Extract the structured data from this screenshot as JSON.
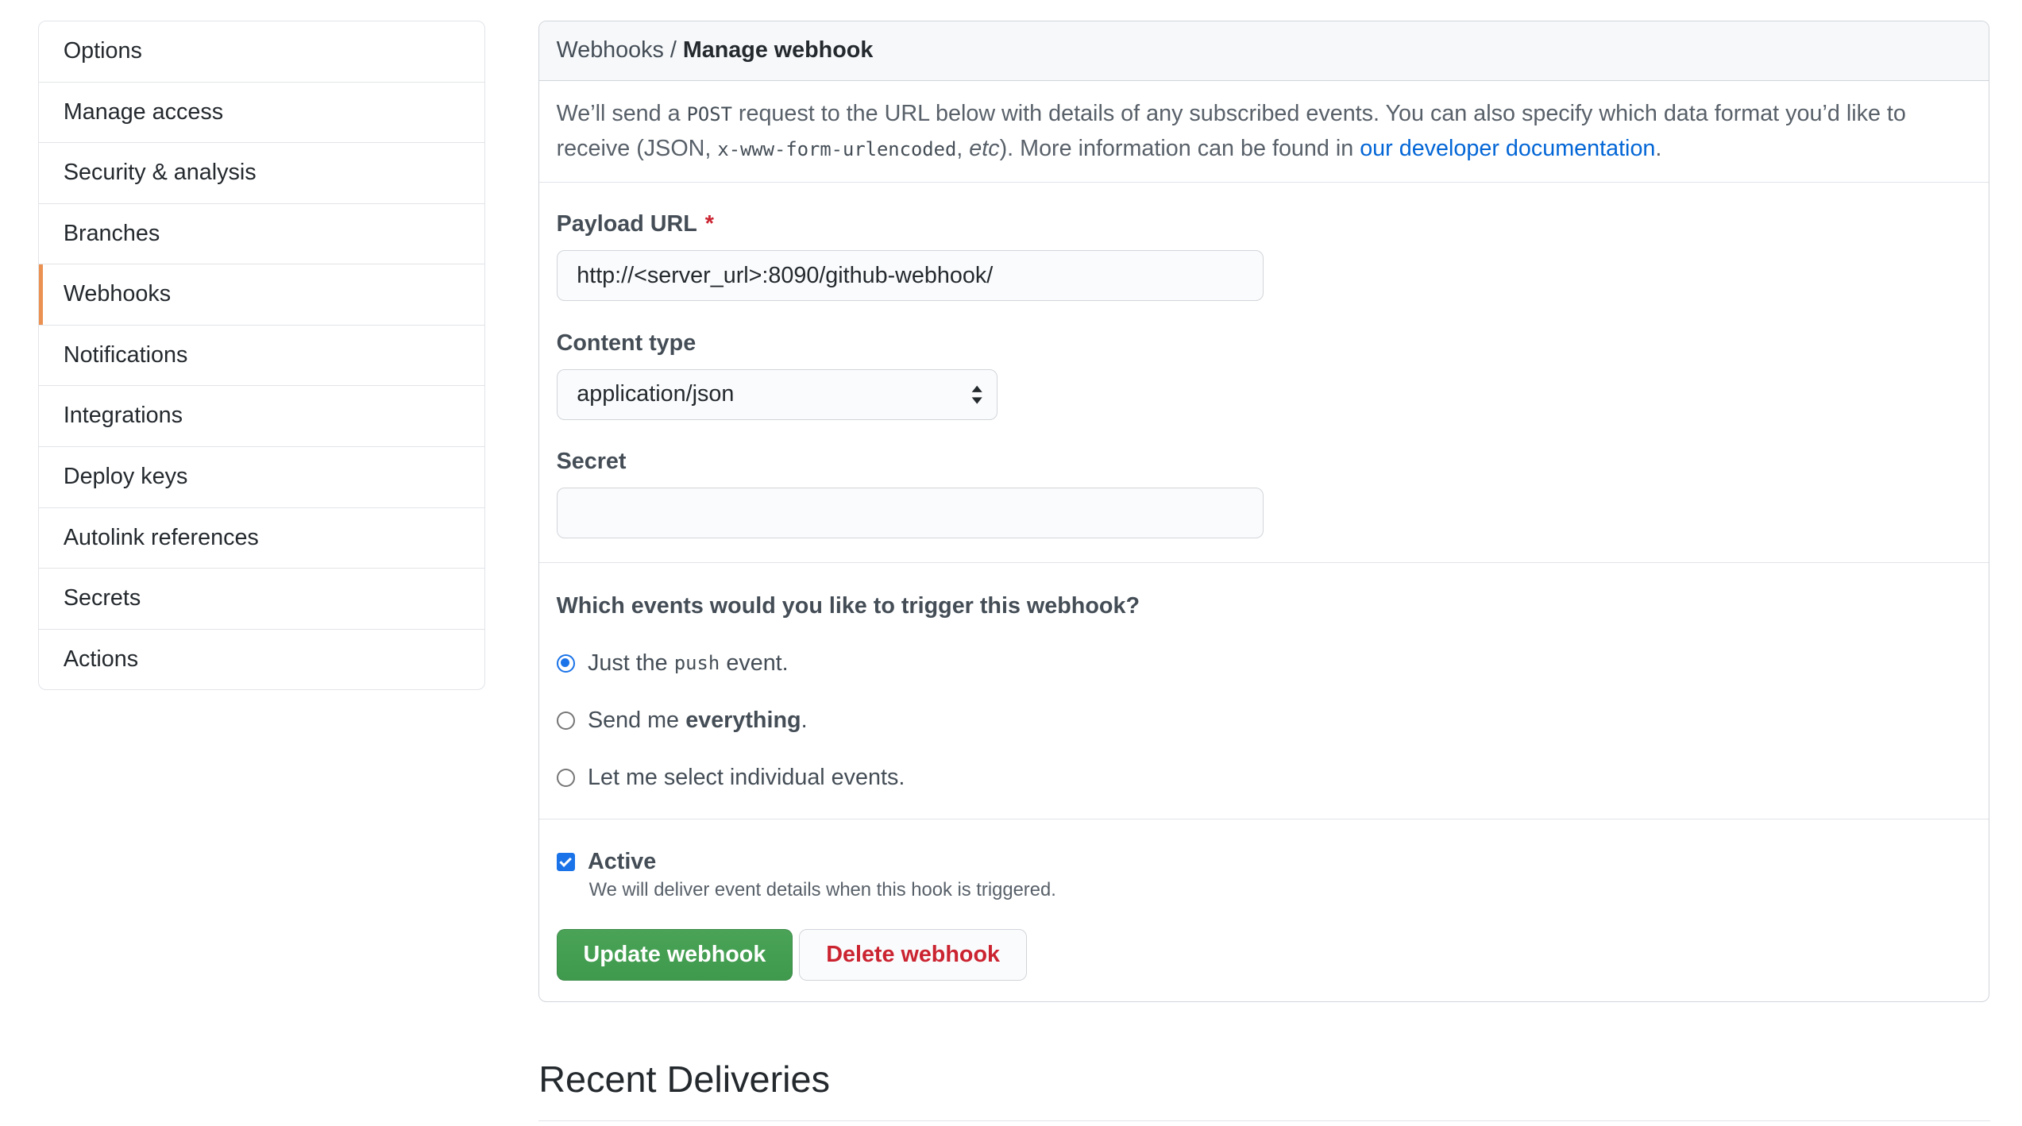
{
  "sidebar": {
    "items": [
      {
        "label": "Options"
      },
      {
        "label": "Manage access"
      },
      {
        "label": "Security & analysis"
      },
      {
        "label": "Branches"
      },
      {
        "label": "Webhooks",
        "selected": true
      },
      {
        "label": "Notifications"
      },
      {
        "label": "Integrations"
      },
      {
        "label": "Deploy keys"
      },
      {
        "label": "Autolink references"
      },
      {
        "label": "Secrets"
      },
      {
        "label": "Actions"
      }
    ]
  },
  "breadcrumb": {
    "parent": "Webhooks",
    "separator": "/",
    "current": "Manage webhook"
  },
  "intro": {
    "part1": "We’ll send a",
    "method": "POST",
    "part2": "request to the URL below with details of any subscribed events. You can also specify which data format you’d like to receive (JSON,",
    "format": "x-www-form-urlencoded",
    "comma": ",",
    "etc": "etc",
    "part3": "). More information can be found in",
    "link": "our developer documentation",
    "period": "."
  },
  "form": {
    "payload_url": {
      "label": "Payload URL",
      "required_mark": "*",
      "value": "http://<server_url>:8090/github-webhook/"
    },
    "content_type": {
      "label": "Content type",
      "selected": "application/json"
    },
    "secret": {
      "label": "Secret",
      "value": ""
    }
  },
  "events": {
    "question": "Which events would you like to trigger this webhook?",
    "options": [
      {
        "pre": "Just the",
        "code": "push",
        "post": "event.",
        "checked": true
      },
      {
        "pre": "Send me",
        "bold": "everything",
        "post": ".",
        "checked": false
      },
      {
        "label": "Let me select individual events.",
        "checked": false
      }
    ]
  },
  "active": {
    "label": "Active",
    "checked": true,
    "note": "We will deliver event details when this hook is triggered."
  },
  "buttons": {
    "update": "Update webhook",
    "delete": "Delete webhook"
  },
  "recent": {
    "title": "Recent Deliveries"
  },
  "colors": {
    "link": "#0366d6",
    "primary_button": "#3f9a4d",
    "danger_text": "#cb2431",
    "selected_indicator": "#e36209",
    "radio_checked": "#1a73e8"
  }
}
